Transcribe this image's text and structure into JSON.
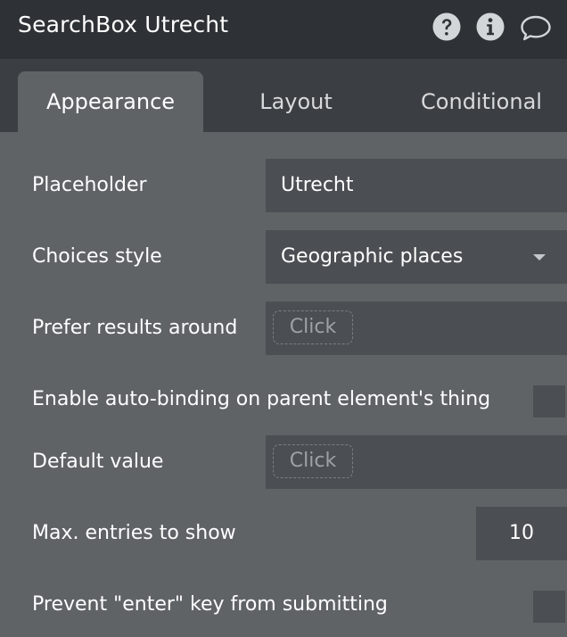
{
  "header": {
    "title": "SearchBox Utrecht",
    "icons": [
      "help-icon",
      "info-icon",
      "comment-icon"
    ]
  },
  "tabs": [
    {
      "label": "Appearance",
      "active": true
    },
    {
      "label": "Layout",
      "active": false
    },
    {
      "label": "Conditional",
      "active": false
    }
  ],
  "form": {
    "placeholder": {
      "label": "Placeholder",
      "value": "Utrecht"
    },
    "choices_style": {
      "label": "Choices style",
      "value": "Geographic places"
    },
    "prefer_results": {
      "label": "Prefer results around",
      "button": "Click"
    },
    "auto_binding": {
      "label": "Enable auto-binding on parent element's thing",
      "checked": false
    },
    "default_value": {
      "label": "Default value",
      "button": "Click"
    },
    "max_entries": {
      "label": "Max. entries to show",
      "value": "10"
    },
    "prevent_enter": {
      "label": "Prevent \"enter\" key from submitting",
      "checked": false
    }
  },
  "colors": {
    "header_bg": "#2e3236",
    "tabbar_bg": "#3b3f43",
    "panel_bg": "#5f6366",
    "field_bg": "#4b4f53"
  }
}
